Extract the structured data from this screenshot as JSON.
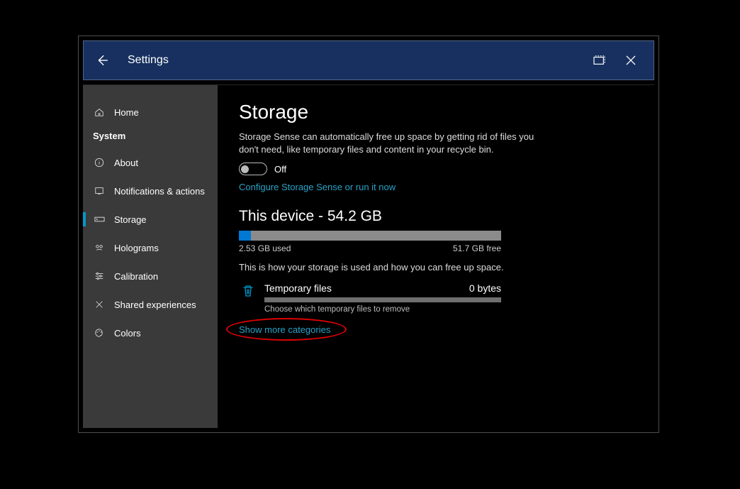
{
  "titlebar": {
    "title": "Settings"
  },
  "sidebar": {
    "home": "Home",
    "group": "System",
    "items": [
      {
        "label": "About"
      },
      {
        "label": "Notifications & actions"
      },
      {
        "label": "Storage"
      },
      {
        "label": "Holograms"
      },
      {
        "label": "Calibration"
      },
      {
        "label": "Shared experiences"
      },
      {
        "label": "Colors"
      }
    ]
  },
  "main": {
    "heading": "Storage",
    "sense_desc": "Storage Sense can automatically free up space by getting rid of files you don't need, like temporary files and content in your recycle bin.",
    "toggle_state": "Off",
    "configure_link": "Configure Storage Sense or run it now",
    "device_heading": "This device - 54.2 GB",
    "used_label": "2.53 GB used",
    "free_label": "51.7 GB free",
    "used_percent": 4.7,
    "usage_desc": "This is how your storage is used and how you can free up space.",
    "category": {
      "name": "Temporary files",
      "size": "0 bytes",
      "sub": "Choose which temporary files to remove"
    },
    "show_more": "Show more categories"
  }
}
